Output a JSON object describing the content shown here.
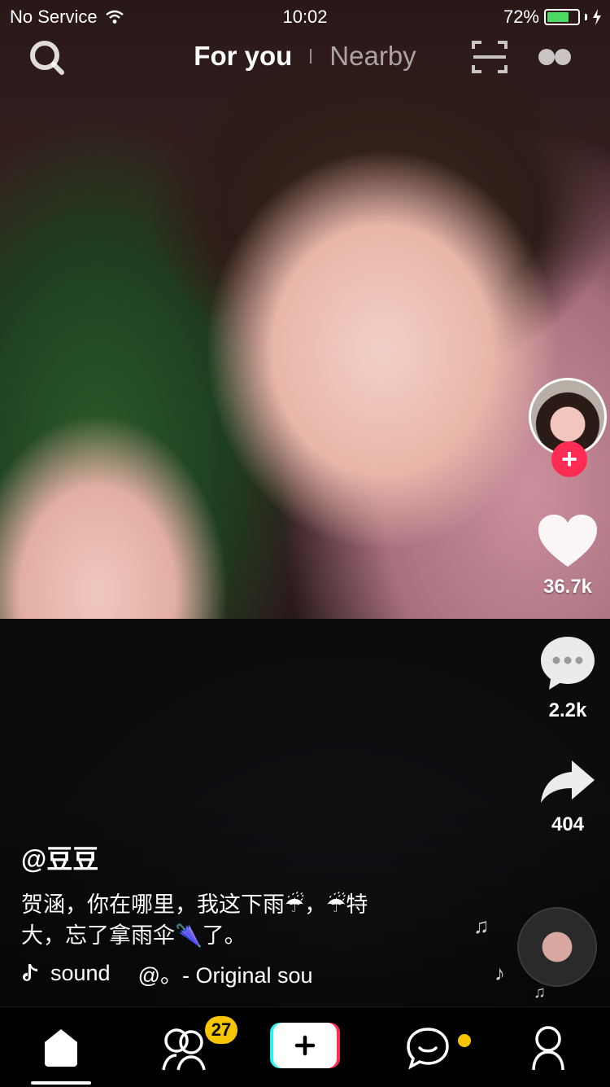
{
  "status": {
    "carrier": "No Service",
    "time": "10:02",
    "battery_percent": "72%",
    "battery_level": 0.72
  },
  "top_nav": {
    "tabs": [
      {
        "label": "For you",
        "active": true
      },
      {
        "label": "Nearby",
        "active": false
      }
    ]
  },
  "rail": {
    "likes": "36.7k",
    "comments": "2.2k",
    "shares": "404"
  },
  "post": {
    "username": "@豆豆",
    "caption_line1": "贺涵，你在哪里，我这下雨☔，☔特",
    "caption_line2": "大，忘了拿雨伞🌂了。",
    "sound_label": "sound",
    "sound_track": "@。- Original sou"
  },
  "tabbar": {
    "inbox_badge": "27"
  },
  "colors": {
    "accent": "#fe2c55",
    "badge": "#f7c600",
    "battery": "#4cd964"
  }
}
